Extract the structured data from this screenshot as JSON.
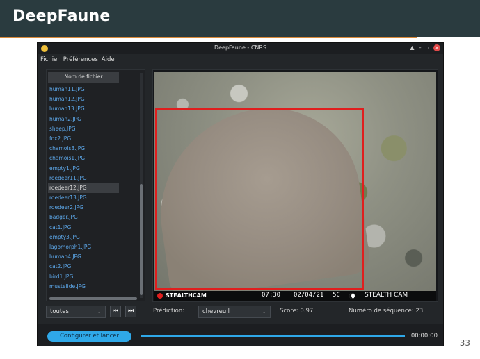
{
  "slide": {
    "title": "DeepFaune",
    "page_number": "33"
  },
  "window": {
    "title": "DeepFaune - CNRS",
    "controls": [
      "▲",
      "–",
      "▫",
      "×"
    ]
  },
  "menu": [
    "Fichier",
    "Préférences",
    "Aide"
  ],
  "file_panel": {
    "header": "Nom de fichier",
    "files": [
      "human11.JPG",
      "human12.JPG",
      "human13.JPG",
      "human2.JPG",
      "sheep.JPG",
      "fox2.JPG",
      "chamois3.JPG",
      "chamois1.JPG",
      "empty1.JPG",
      "roedeer11.JPG",
      "roedeer12.JPG",
      "roedeer13.JPG",
      "roedeer2.JPG",
      "badger.JPG",
      "cat1.JPG",
      "empty3.JPG",
      "lagomorph1.JPG",
      "human4.JPG",
      "cat2.JPG",
      "bird1.JPG",
      "mustelide.JPG"
    ],
    "selected_index": 10
  },
  "camera_strip": {
    "brand": "STEALTHCAM",
    "time": "07:30",
    "date": "02/04/21",
    "temp": "5C",
    "name": "STEALTH CAM"
  },
  "controls": {
    "filter_value": "toutes",
    "prev_icon": "skip-previous-icon",
    "next_icon": "skip-next-icon",
    "prediction_label": "Prédiction:",
    "prediction_value": "chevreuil",
    "score_text": "Score: 0.97",
    "sequence_text": "Numéro de séquence: 23"
  },
  "footer": {
    "run_button": "Configurer et lancer",
    "timer": "00:00:00"
  },
  "colors": {
    "accent": "#2fa8e8",
    "bbox": "#e01e1e",
    "header_bg": "#2a3b3f",
    "header_line": "#d98a3a"
  }
}
